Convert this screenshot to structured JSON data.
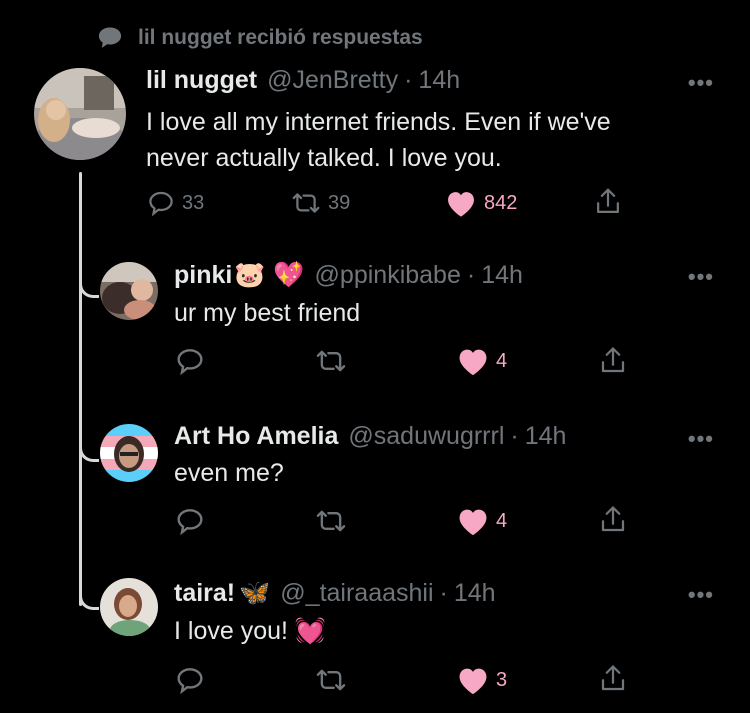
{
  "social_context": {
    "text": "lil nugget recibió respuestas",
    "icon": "speech-bubble-icon"
  },
  "main_tweet": {
    "name": "lil nugget",
    "handle": "@JenBretty",
    "separator": "·",
    "time": "14h",
    "text_line1": "I love all my internet friends. Even if we've",
    "text_line2": "never actually talked. I love you.",
    "replies": "33",
    "retweets": "39",
    "likes": "842"
  },
  "replies": [
    {
      "name": "pinki",
      "name_emoji": "🐷 💖",
      "handle": "@ppinkibabe",
      "separator": "·",
      "time": "14h",
      "text": "ur my best friend",
      "text_emoji": "",
      "likes": "4"
    },
    {
      "name": "Art Ho Amelia",
      "name_emoji": "",
      "handle": "@saduwugrrrl",
      "separator": "·",
      "time": "14h",
      "text": "even me?",
      "text_emoji": "",
      "likes": "4"
    },
    {
      "name": "taira!",
      "name_emoji": "🦋",
      "handle": "@_tairaaashii",
      "separator": "·",
      "time": "14h",
      "text": "I love you!",
      "text_emoji": "💓",
      "likes": "3"
    }
  ],
  "more_label": "•••",
  "colors": {
    "background": "#000000",
    "text": "#e7e9ea",
    "muted": "#71767b",
    "like_pink": "#f7a8c4",
    "thread_line": "#d9d9d9"
  }
}
